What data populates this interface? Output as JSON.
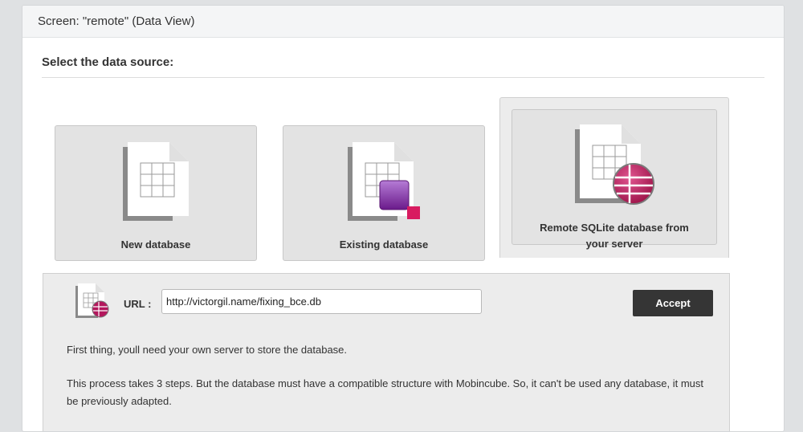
{
  "header": {
    "title": "Screen: \"remote\" (Data View)"
  },
  "section": {
    "title": "Select the data source:"
  },
  "cards": [
    {
      "label": "New database",
      "icon": "new-database-icon"
    },
    {
      "label": "Existing database",
      "icon": "existing-database-icon"
    },
    {
      "label": "Remote SQLite database from your server",
      "icon": "remote-database-icon",
      "selected": true
    }
  ],
  "url_form": {
    "label": "URL :",
    "value": "http://victorgil.name/fixing_bce.db",
    "accept_label": "Accept"
  },
  "info": {
    "p1": "First thing, youll need your own server to store the database.",
    "p2": "This process takes 3 steps. But the database must have a compatible structure with Mobincube. So, it can't be used any database, it must be previously adapted."
  },
  "colors": {
    "accent": "#c2185b",
    "button": "#353535",
    "purple": "#8e24aa"
  }
}
